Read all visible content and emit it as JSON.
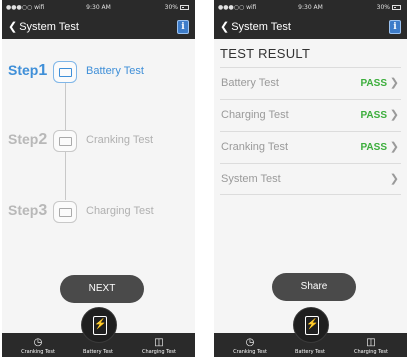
{
  "status_bar": {
    "carrier": "●●●○○ wifi",
    "time": "9:30 AM",
    "battery": "30%"
  },
  "nav": {
    "back_label": "System Test",
    "back_chevron": "chevron-left-icon",
    "info_icon": "info-book-icon",
    "info_glyph": "i"
  },
  "steps_screen": {
    "steps": [
      {
        "label": "Step",
        "number": "1",
        "name": "Battery Test",
        "icon": "battery-icon",
        "active": true
      },
      {
        "label": "Step",
        "number": "2",
        "name": "Cranking Test",
        "icon": "battery-icon",
        "active": false
      },
      {
        "label": "Step",
        "number": "3",
        "name": "Charging Test",
        "icon": "battery-icon",
        "active": false
      }
    ],
    "next_button": "NEXT"
  },
  "results_screen": {
    "title": "TEST RESULT",
    "rows": [
      {
        "name": "Battery Test",
        "status": "PASS"
      },
      {
        "name": "Charging Test",
        "status": "PASS"
      },
      {
        "name": "Cranking Test",
        "status": "PASS"
      },
      {
        "name": "System Test",
        "status": ""
      }
    ],
    "share_button": "Share"
  },
  "tab_bar": {
    "tabs": [
      {
        "label": "Cranking Test",
        "icon": "speedometer-icon"
      },
      {
        "label": "Battery Test",
        "icon": "phone-battery-icon"
      },
      {
        "label": "Charging Test",
        "icon": "battery-icon"
      }
    ]
  },
  "colors": {
    "accent": "#3f8fd8",
    "pass": "#3cae3c",
    "bar": "#2a2a2a"
  }
}
